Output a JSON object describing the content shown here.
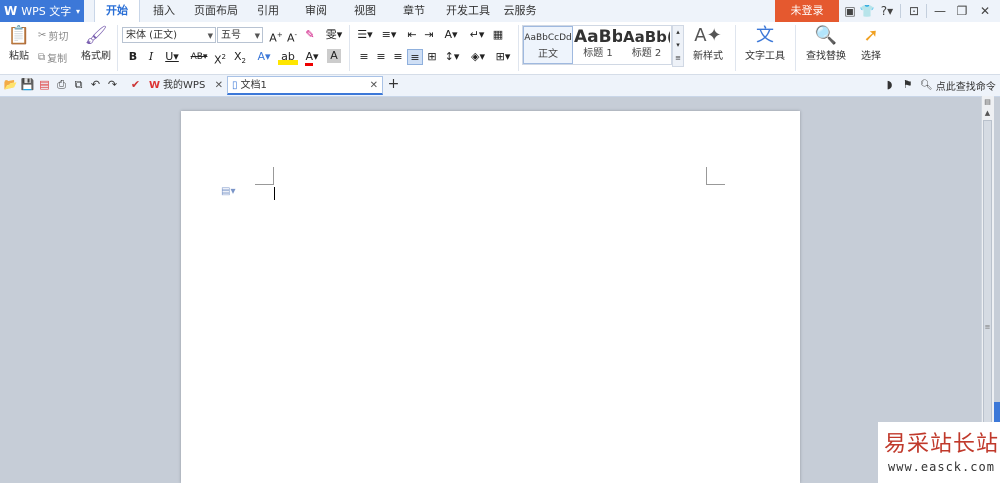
{
  "app": {
    "name": "WPS 文字"
  },
  "menu": {
    "tabs": [
      "开始",
      "插入",
      "页面布局",
      "引用",
      "审阅",
      "视图",
      "章节",
      "开发工具",
      "云服务"
    ],
    "active_tab": "开始",
    "login_label": "未登录"
  },
  "ribbon": {
    "clipboard": {
      "paste": "粘贴",
      "cut": "剪切",
      "copy": "复制",
      "format_painter": "格式刷"
    },
    "font": {
      "name": "宋体 (正文)",
      "size": "五号"
    },
    "styles": [
      {
        "preview": "AaBbCcDd",
        "label": "正文"
      },
      {
        "preview": "AaBb",
        "label": "标题 1"
      },
      {
        "preview": "AaBb(",
        "label": "标题 2"
      }
    ],
    "new_style": "新样式",
    "text_tools": "文字工具",
    "find_replace": "查找替换",
    "select": "选择"
  },
  "tabbar": {
    "tabs": [
      {
        "label": "我的WPS",
        "active": false
      },
      {
        "label": "文档1",
        "active": true
      }
    ],
    "search_placeholder": "点此查找命令"
  },
  "watermark": {
    "cn": "易采站长站",
    "url": "www.easck.com"
  },
  "colors": {
    "accent": "#3c78d8",
    "login": "#e5592f",
    "page_bg": "#c6cdd7"
  }
}
